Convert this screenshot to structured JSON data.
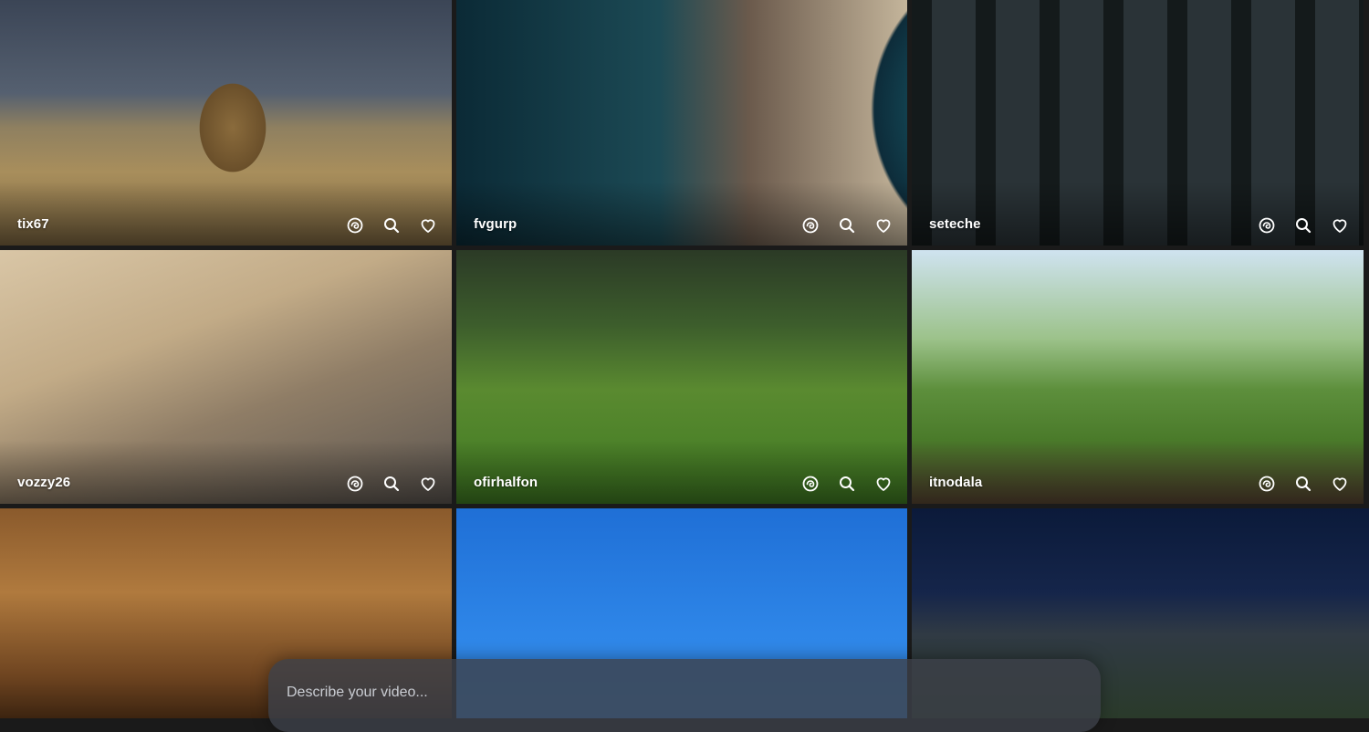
{
  "feed": {
    "tiles": [
      {
        "username": "tix67"
      },
      {
        "username": "fvgurp"
      },
      {
        "username": "seteche"
      },
      {
        "username": "vozzy26"
      },
      {
        "username": "ofirhalfon"
      },
      {
        "username": "itnodala"
      },
      {
        "username": ""
      },
      {
        "username": ""
      },
      {
        "username": ""
      }
    ],
    "actions": [
      "remix-icon",
      "search-icon",
      "heart-icon"
    ]
  },
  "prompt": {
    "placeholder": "Describe your video..."
  },
  "colors": {
    "prompt_bar_bg": "#3c4048",
    "text": "#ffffff"
  }
}
